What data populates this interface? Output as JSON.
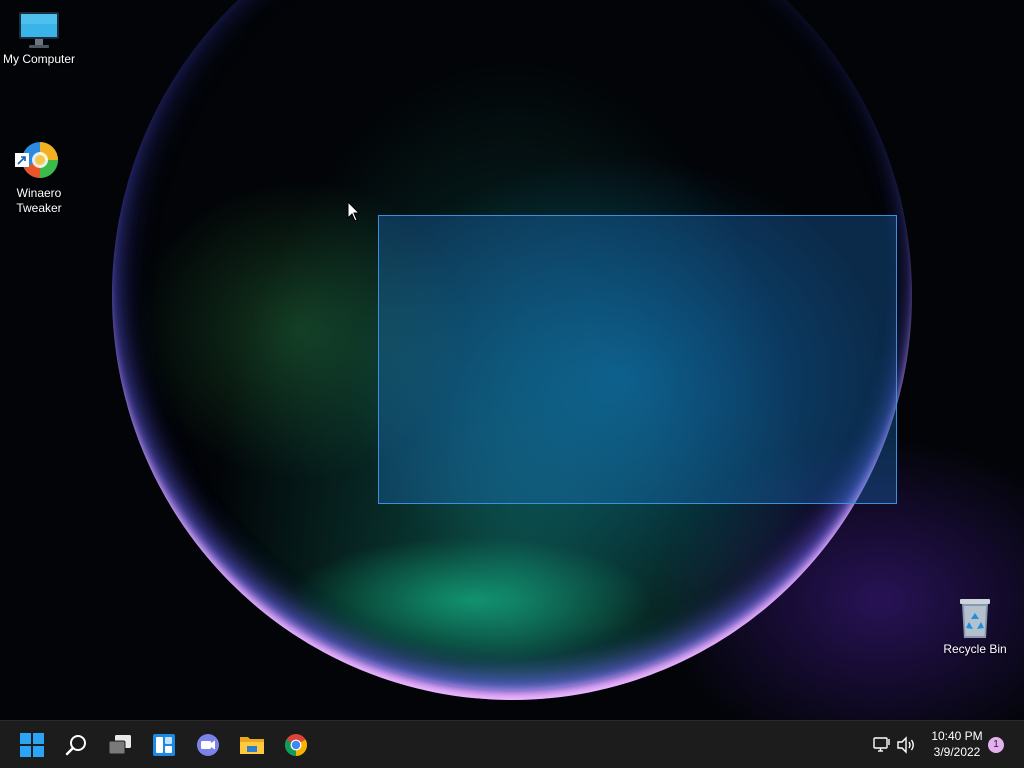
{
  "desktop": {
    "icons": [
      {
        "label": "My Computer",
        "icon": "monitor-icon"
      },
      {
        "label": "Winaero\nTweaker",
        "icon": "winaero-tweaker-icon"
      },
      {
        "label": "Recycle Bin",
        "icon": "recycle-bin-icon"
      }
    ],
    "selection_active": true
  },
  "taskbar": {
    "buttons": [
      {
        "name": "start",
        "icon": "windows-logo-icon"
      },
      {
        "name": "search",
        "icon": "search-icon"
      },
      {
        "name": "task-view",
        "icon": "task-view-icon"
      },
      {
        "name": "widgets",
        "icon": "widgets-icon"
      },
      {
        "name": "chat",
        "icon": "teams-chat-icon"
      },
      {
        "name": "file-explorer",
        "icon": "folder-icon"
      },
      {
        "name": "chrome",
        "icon": "chrome-icon"
      }
    ],
    "tray": {
      "network_icon": "network-icon",
      "volume_icon": "speaker-icon",
      "time": "10:40 PM",
      "date": "3/9/2022",
      "notification_count": "1"
    }
  },
  "colors": {
    "taskbar_bg": "#1c1c1c",
    "selection_border": "#3c96e6",
    "windows_blue": "#2aa4f4",
    "badge": "#e4b0f0"
  }
}
